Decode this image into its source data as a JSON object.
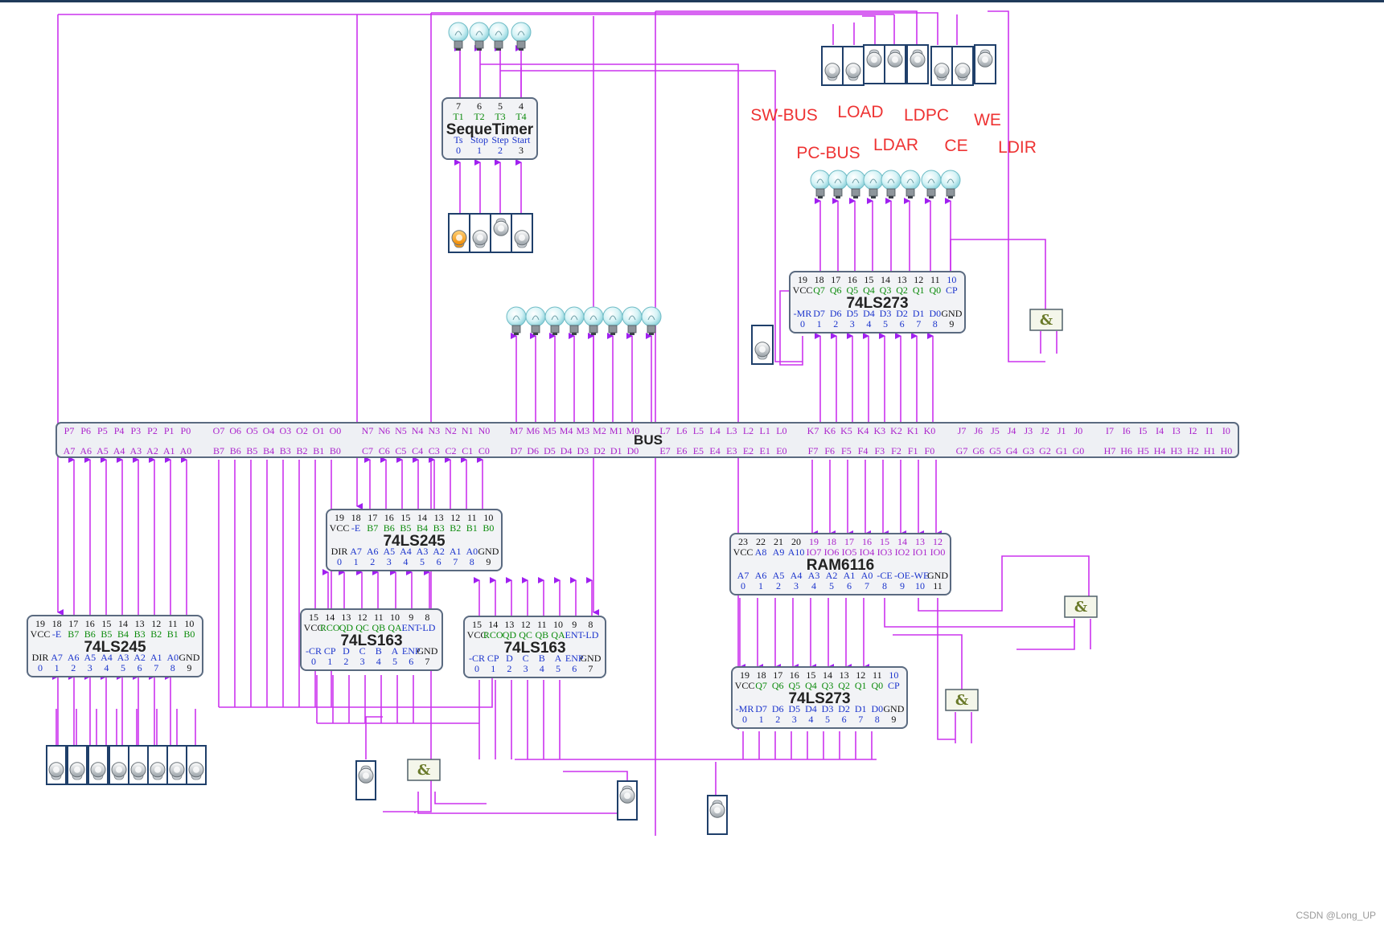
{
  "colors": {
    "wire": "#cc33ee",
    "wire_dark": "#a020f0",
    "chip_border": "#5a6a80",
    "chip_fill": "#f2f3f6",
    "num_black": "#111111",
    "num_blue": "#1a33cc",
    "num_green": "#0a8a0a",
    "num_purple": "#aa22cc",
    "label_red": "#ee3333",
    "top_bar": "#1f3a5a",
    "and_fill": "#f4f6ea"
  },
  "control_labels": [
    "SW-BUS",
    "LOAD",
    "LDPC",
    "WE",
    "PC-BUS",
    "LDAR",
    "CE",
    "LDIR"
  ],
  "bus": {
    "title": "BUS",
    "top_groups": [
      [
        "P7",
        "P6",
        "P5",
        "P4",
        "P3",
        "P2",
        "P1",
        "P0"
      ],
      [
        "O7",
        "O6",
        "O5",
        "O4",
        "O3",
        "O2",
        "O1",
        "O0"
      ],
      [
        "N7",
        "N6",
        "N5",
        "N4",
        "N3",
        "N2",
        "N1",
        "N0"
      ],
      [
        "M7",
        "M6",
        "M5",
        "M4",
        "M3",
        "M2",
        "M1",
        "M0"
      ],
      [
        "L7",
        "L6",
        "L5",
        "L4",
        "L3",
        "L2",
        "L1",
        "L0"
      ],
      [
        "K7",
        "K6",
        "K5",
        "K4",
        "K3",
        "K2",
        "K1",
        "K0"
      ],
      [
        "J7",
        "J6",
        "J5",
        "J4",
        "J3",
        "J2",
        "J1",
        "J0"
      ],
      [
        "I7",
        "I6",
        "I5",
        "I4",
        "I3",
        "I2",
        "I1",
        "I0"
      ]
    ],
    "bottom_groups": [
      [
        "A7",
        "A6",
        "A5",
        "A4",
        "A3",
        "A2",
        "A1",
        "A0"
      ],
      [
        "B7",
        "B6",
        "B5",
        "B4",
        "B3",
        "B2",
        "B1",
        "B0"
      ],
      [
        "C7",
        "C6",
        "C5",
        "C4",
        "C3",
        "C2",
        "C1",
        "C0"
      ],
      [
        "D7",
        "D6",
        "D5",
        "D4",
        "D3",
        "D2",
        "D1",
        "D0"
      ],
      [
        "E7",
        "E6",
        "E5",
        "E4",
        "E3",
        "E2",
        "E1",
        "E0"
      ],
      [
        "F7",
        "F6",
        "F5",
        "F4",
        "F3",
        "F2",
        "F1",
        "F0"
      ],
      [
        "G7",
        "G6",
        "G5",
        "G4",
        "G3",
        "G2",
        "G1",
        "G0"
      ],
      [
        "H7",
        "H6",
        "H5",
        "H4",
        "H3",
        "H2",
        "H1",
        "H0"
      ]
    ]
  },
  "chips": [
    {
      "id": "seque-timer",
      "name": "SequeTimer",
      "top_nums": [
        "7",
        "6",
        "5",
        "4"
      ],
      "top_pins": [
        "T1",
        "T2",
        "T3",
        "T4"
      ],
      "bot_pins": [
        "Ts",
        "Stop",
        "Step",
        "Start"
      ],
      "bot_nums": [
        "0",
        "1",
        "2",
        "3"
      ]
    },
    {
      "id": "ls273-top",
      "name": "74LS273",
      "top_nums": [
        "19",
        "18",
        "17",
        "16",
        "15",
        "14",
        "13",
        "12",
        "11",
        "10"
      ],
      "top_pins": [
        "VCC",
        "Q7",
        "Q6",
        "Q5",
        "Q4",
        "Q3",
        "Q2",
        "Q1",
        "Q0",
        "CP"
      ],
      "bot_pins": [
        "-MR",
        "D7",
        "D6",
        "D5",
        "D4",
        "D3",
        "D2",
        "D1",
        "D0",
        "GND"
      ],
      "bot_nums": [
        "0",
        "1",
        "2",
        "3",
        "4",
        "5",
        "6",
        "7",
        "8",
        "9"
      ]
    },
    {
      "id": "ls245-left",
      "name": "74LS245",
      "top_nums": [
        "19",
        "18",
        "17",
        "16",
        "15",
        "14",
        "13",
        "12",
        "11",
        "10"
      ],
      "top_pins": [
        "VCC",
        "-E",
        "B7",
        "B6",
        "B5",
        "B4",
        "B3",
        "B2",
        "B1",
        "B0"
      ],
      "bot_pins": [
        "DIR",
        "A7",
        "A6",
        "A5",
        "A4",
        "A3",
        "A2",
        "A1",
        "A0",
        "GND"
      ],
      "bot_nums": [
        "0",
        "1",
        "2",
        "3",
        "4",
        "5",
        "6",
        "7",
        "8",
        "9"
      ]
    },
    {
      "id": "ls245-mid",
      "name": "74LS245",
      "top_nums": [
        "19",
        "18",
        "17",
        "16",
        "15",
        "14",
        "13",
        "12",
        "11",
        "10"
      ],
      "top_pins": [
        "VCC",
        "-E",
        "B7",
        "B6",
        "B5",
        "B4",
        "B3",
        "B2",
        "B1",
        "B0"
      ],
      "bot_pins": [
        "DIR",
        "A7",
        "A6",
        "A5",
        "A4",
        "A3",
        "A2",
        "A1",
        "A0",
        "GND"
      ],
      "bot_nums": [
        "0",
        "1",
        "2",
        "3",
        "4",
        "5",
        "6",
        "7",
        "8",
        "9"
      ]
    },
    {
      "id": "ls163-a",
      "name": "74LS163",
      "top_nums": [
        "15",
        "14",
        "13",
        "12",
        "11",
        "10",
        "9",
        "8"
      ],
      "top_pins": [
        "VCC",
        "RCO",
        "QD",
        "QC",
        "QB",
        "QA",
        "ENT",
        "-LD"
      ],
      "bot_pins": [
        "-CR",
        "CP",
        "D",
        "C",
        "B",
        "A",
        "ENP",
        "GND"
      ],
      "bot_nums": [
        "0",
        "1",
        "2",
        "3",
        "4",
        "5",
        "6",
        "7"
      ]
    },
    {
      "id": "ls163-b",
      "name": "74LS163",
      "top_nums": [
        "15",
        "14",
        "13",
        "12",
        "11",
        "10",
        "9",
        "8"
      ],
      "top_pins": [
        "VCC",
        "RCO",
        "QD",
        "QC",
        "QB",
        "QA",
        "ENT",
        "-LD"
      ],
      "bot_pins": [
        "-CR",
        "CP",
        "D",
        "C",
        "B",
        "A",
        "ENP",
        "GND"
      ],
      "bot_nums": [
        "0",
        "1",
        "2",
        "3",
        "4",
        "5",
        "6",
        "7"
      ]
    },
    {
      "id": "ram6116",
      "name": "RAM6116",
      "top_nums": [
        "23",
        "22",
        "21",
        "20",
        "19",
        "18",
        "17",
        "16",
        "15",
        "14",
        "13",
        "12"
      ],
      "top_pins": [
        "VCC",
        "A8",
        "A9",
        "A10",
        "IO7",
        "IO6",
        "IO5",
        "IO4",
        "IO3",
        "IO2",
        "IO1",
        "IO0"
      ],
      "bot_pins": [
        "A7",
        "A6",
        "A5",
        "A4",
        "A3",
        "A2",
        "A1",
        "A0",
        "-CE",
        "-OE",
        "-WE",
        "GND"
      ],
      "bot_nums": [
        "0",
        "1",
        "2",
        "3",
        "4",
        "5",
        "6",
        "7",
        "8",
        "9",
        "10",
        "11"
      ]
    },
    {
      "id": "ls273-bot",
      "name": "74LS273",
      "top_nums": [
        "19",
        "18",
        "17",
        "16",
        "15",
        "14",
        "13",
        "12",
        "11",
        "10"
      ],
      "top_pins": [
        "VCC",
        "Q7",
        "Q6",
        "Q5",
        "Q4",
        "Q3",
        "Q2",
        "Q1",
        "Q0",
        "CP"
      ],
      "bot_pins": [
        "-MR",
        "D7",
        "D6",
        "D5",
        "D4",
        "D3",
        "D2",
        "D1",
        "D0",
        "GND"
      ],
      "bot_nums": [
        "0",
        "1",
        "2",
        "3",
        "4",
        "5",
        "6",
        "7",
        "8",
        "9"
      ]
    }
  ],
  "and_gate_symbol": "&",
  "watermark": "CSDN @Long_UP"
}
